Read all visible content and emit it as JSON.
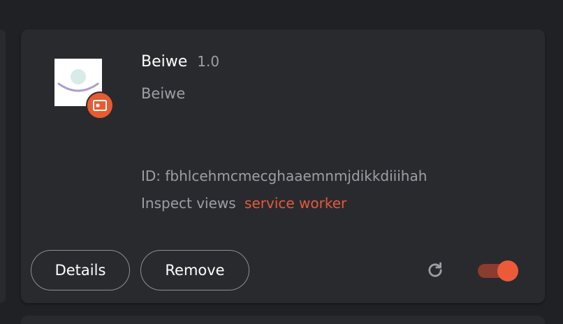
{
  "extension": {
    "name": "Beiwe",
    "version": "1.0",
    "description": "Beiwe",
    "id_text": "ID: fbhlcehmcmecghaaemnmjdikkdiiihah",
    "inspect_label": "Inspect views",
    "inspect_link": "service worker",
    "icon": "beiwe-logo-icon",
    "badge_icon": "unpacked-extension-badge-icon"
  },
  "buttons": {
    "details": "Details",
    "remove": "Remove",
    "reload_icon": "reload-icon"
  },
  "toggle": {
    "enabled": true
  },
  "colors": {
    "background": "#202124",
    "card": "#292a2d",
    "accent": "#e55a3c",
    "secondary_text": "#9aa0a6"
  }
}
